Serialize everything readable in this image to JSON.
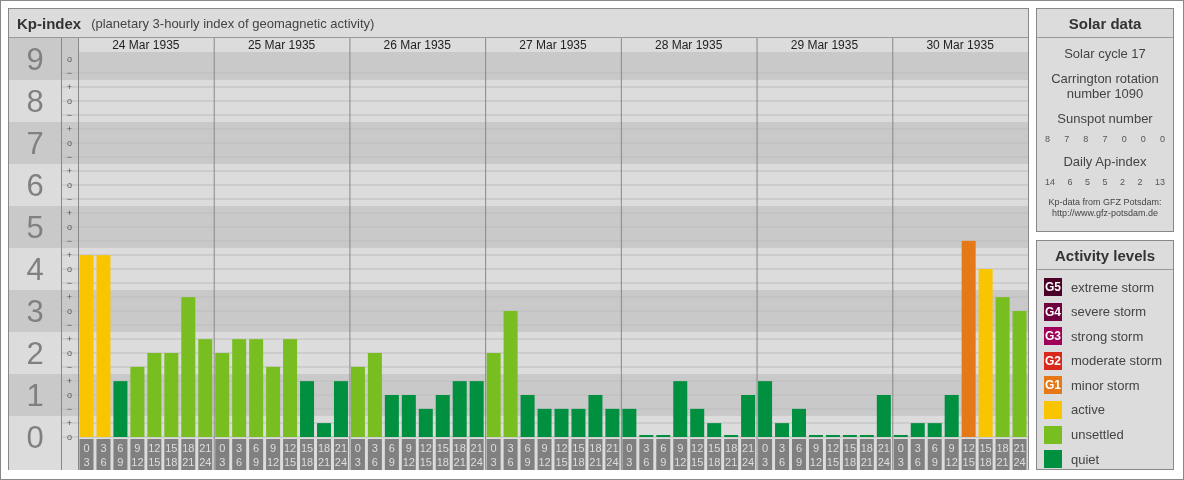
{
  "chart_panel": {
    "title": "Kp-index",
    "subtitle": "(planetary 3-hourly index of geomagnetic activity)",
    "dates": [
      "24 Mar 1935",
      "25 Mar 1935",
      "26 Mar 1935",
      "27 Mar 1935",
      "28 Mar 1935",
      "29 Mar 1935",
      "30 Mar 1935"
    ],
    "scale_marks": [
      "o",
      "−",
      "+",
      "o",
      "−",
      "+",
      "o",
      "−",
      "+",
      "o",
      "−",
      "+",
      "o",
      "−",
      "+",
      "o",
      "−",
      "+",
      "o",
      "−",
      "+",
      "o",
      "−",
      "+",
      "o",
      "−",
      "+",
      "o"
    ],
    "chart_data": {
      "type": "bar",
      "grid": true,
      "ylim": [
        0,
        9.5
      ],
      "yticks": [
        0,
        1,
        2,
        3,
        4,
        5,
        6,
        7,
        8,
        9
      ],
      "categories": [
        "0\n3",
        "3\n6",
        "6\n9",
        "9\n12",
        "12\n15",
        "15\n18",
        "18\n21",
        "21\n24",
        "0\n3",
        "3\n6",
        "6\n9",
        "9\n12",
        "12\n15",
        "15\n18",
        "18\n21",
        "21\n24",
        "0\n3",
        "3\n6",
        "6\n9",
        "9\n12",
        "12\n15",
        "15\n18",
        "18\n21",
        "21\n24",
        "0\n3",
        "3\n6",
        "6\n9",
        "9\n12",
        "12\n15",
        "15\n18",
        "18\n21",
        "21\n24",
        "0\n3",
        "3\n6",
        "6\n9",
        "9\n12",
        "12\n15",
        "15\n18",
        "18\n21",
        "21\n24",
        "0\n3",
        "3\n6",
        "6\n9",
        "9\n12",
        "12\n15",
        "15\n18",
        "18\n21",
        "21\n24",
        "0\n3",
        "3\n6",
        "6\n9",
        "9\n12",
        "12\n15",
        "15\n18",
        "18\n21",
        "21\n24"
      ],
      "series": [
        {
          "color": "#e57917",
          "values": [
            null,
            null,
            null,
            null,
            null,
            null,
            null,
            null,
            null,
            null,
            null,
            null,
            null,
            null,
            null,
            null,
            null,
            null,
            null,
            null,
            null,
            null,
            null,
            null,
            null,
            null,
            null,
            null,
            null,
            null,
            null,
            null,
            null,
            null,
            null,
            null,
            null,
            null,
            null,
            null,
            null,
            null,
            null,
            null,
            null,
            null,
            null,
            null,
            null,
            null,
            null,
            null,
            4.67,
            null,
            null,
            null
          ]
        },
        {
          "color": "#f9c500",
          "values": [
            4.33,
            4.33,
            null,
            null,
            null,
            null,
            null,
            null,
            null,
            null,
            null,
            null,
            null,
            null,
            null,
            null,
            null,
            null,
            null,
            null,
            null,
            null,
            null,
            null,
            null,
            null,
            null,
            null,
            null,
            null,
            null,
            null,
            null,
            null,
            null,
            null,
            null,
            null,
            null,
            null,
            null,
            null,
            null,
            null,
            null,
            null,
            null,
            null,
            null,
            null,
            null,
            null,
            null,
            4,
            null,
            null
          ]
        },
        {
          "color": "#78be20",
          "values": [
            null,
            null,
            null,
            1.67,
            2,
            2,
            3.33,
            2.33,
            2,
            2.33,
            2.33,
            1.67,
            2.33,
            null,
            null,
            null,
            1.67,
            2,
            null,
            null,
            null,
            null,
            null,
            null,
            2,
            3,
            null,
            null,
            null,
            null,
            null,
            null,
            null,
            null,
            null,
            null,
            null,
            null,
            null,
            null,
            null,
            null,
            null,
            null,
            null,
            null,
            null,
            null,
            null,
            null,
            null,
            null,
            null,
            null,
            3.33,
            3
          ]
        },
        {
          "color": "#00903f",
          "values": [
            null,
            null,
            1.33,
            null,
            null,
            null,
            null,
            null,
            null,
            null,
            null,
            null,
            null,
            1.33,
            0.33,
            1.33,
            null,
            null,
            1,
            1,
            0.67,
            1,
            1.33,
            1.33,
            null,
            null,
            1,
            0.67,
            0.67,
            0.67,
            1,
            0.67,
            0.67,
            0,
            0,
            1.33,
            0.67,
            0.33,
            0,
            1,
            1.33,
            0.33,
            0.67,
            0,
            0,
            0,
            0,
            1,
            0,
            0.33,
            0.33,
            1,
            null,
            null,
            null,
            null
          ]
        }
      ]
    }
  },
  "solar_data": {
    "title": "Solar data",
    "solar_cycle": "Solar cycle 17",
    "carrington": "Carrington rotation number 1090",
    "sunspot_title": "Sunspot number",
    "sunspot_values": [
      "8",
      "7",
      "8",
      "7",
      "0",
      "0",
      "0"
    ],
    "ap_title": "Daily Ap-index",
    "ap_values": [
      "14",
      "6",
      "5",
      "5",
      "2",
      "2",
      "13"
    ],
    "source_lines": [
      "Kp-data from GFZ Potsdam:",
      "http://www.gfz-potsdam.de"
    ]
  },
  "activity_levels": {
    "title": "Activity levels",
    "items": [
      {
        "badge": "G5",
        "label": "extreme storm",
        "color": "#4a0027"
      },
      {
        "badge": "G4",
        "label": "severe storm",
        "color": "#6e0040"
      },
      {
        "badge": "G3",
        "label": "strong storm",
        "color": "#a0005a"
      },
      {
        "badge": "G2",
        "label": "moderate storm",
        "color": "#d8291c"
      },
      {
        "badge": "G1",
        "label": "minor storm",
        "color": "#e57917"
      },
      {
        "label": "active",
        "color": "#f9c500"
      },
      {
        "label": "unsettled",
        "color": "#78be20"
      },
      {
        "label": "quiet",
        "color": "#00903f"
      }
    ]
  }
}
